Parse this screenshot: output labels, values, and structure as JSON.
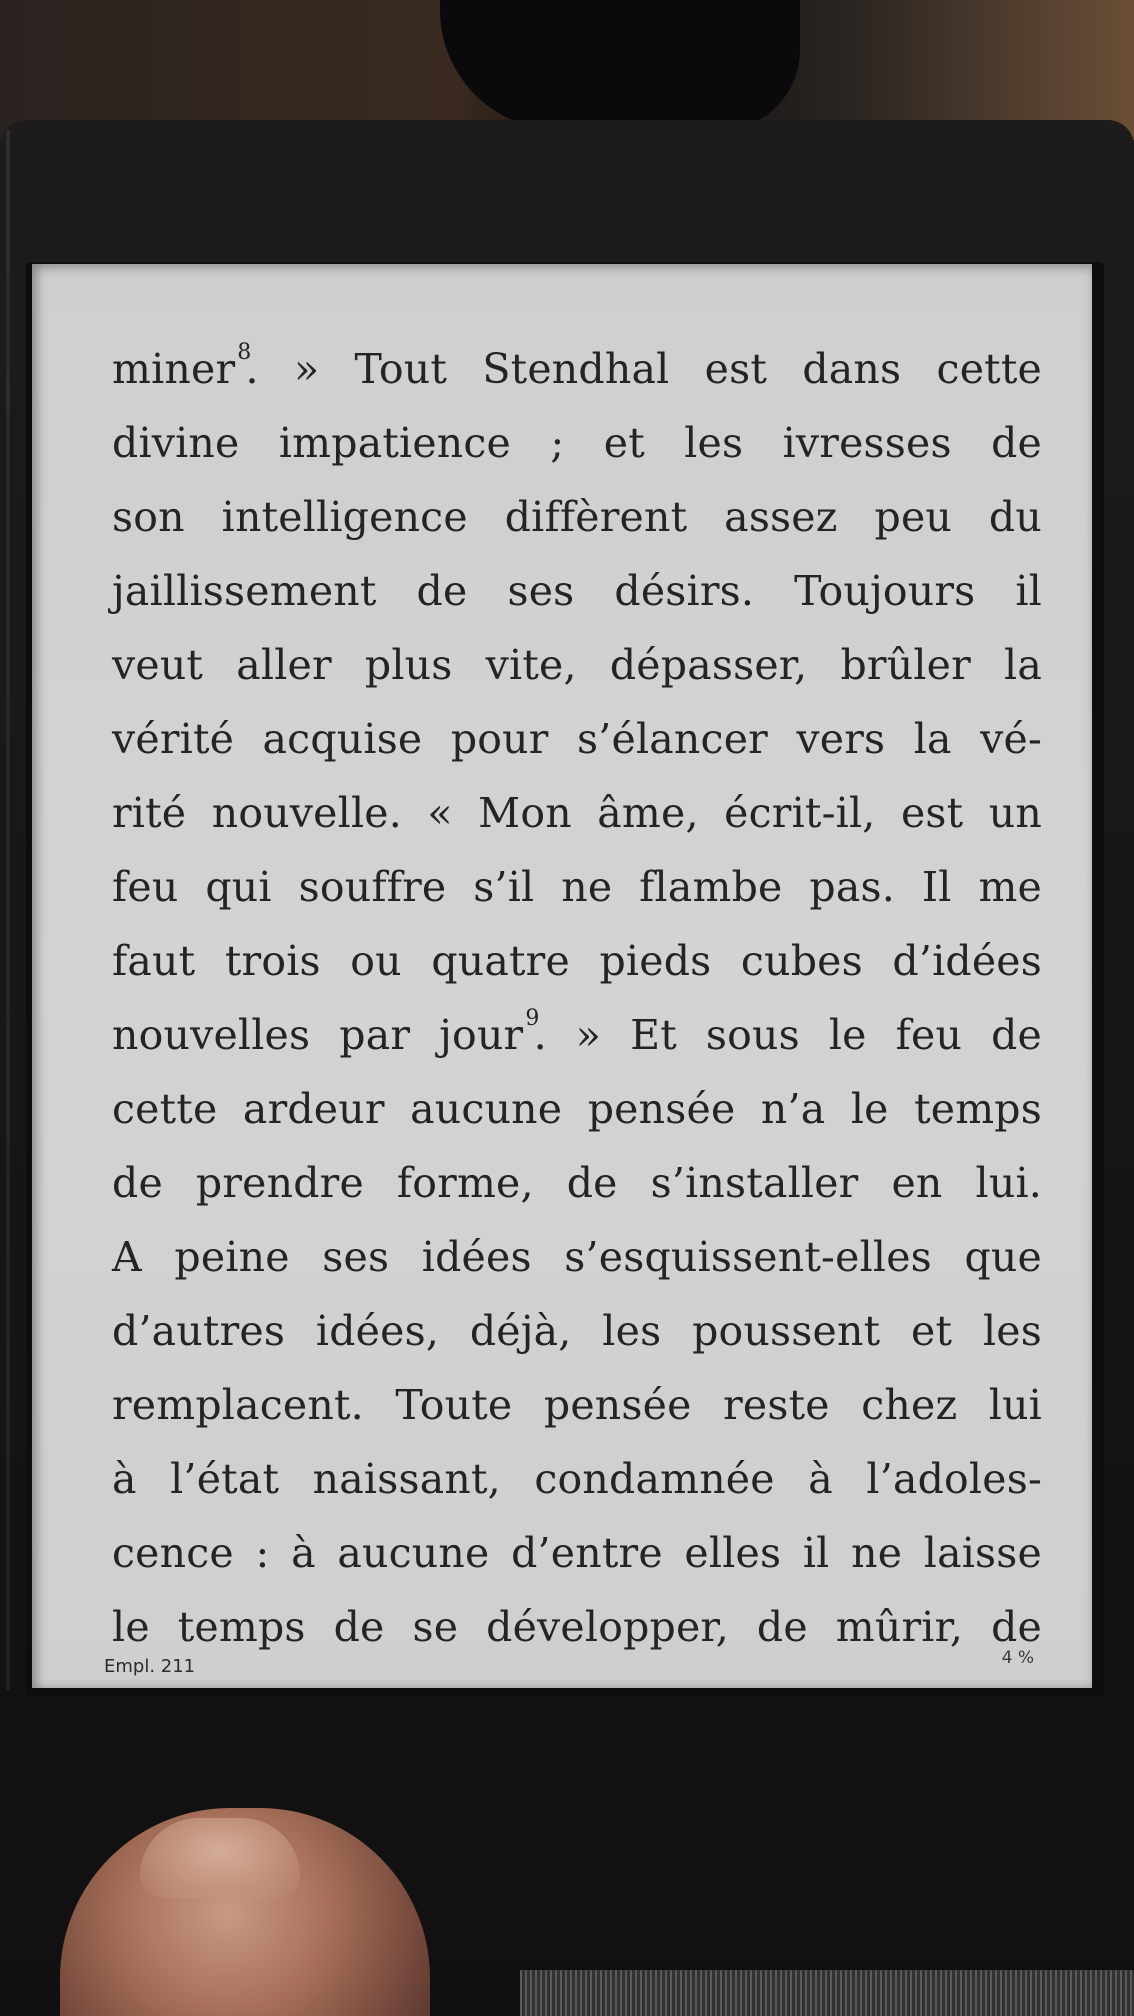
{
  "reader": {
    "paragraph_lines": [
      {
        "before": "miner",
        "ref": "8",
        "after": ". » Tout Stendhal est dans cette"
      },
      {
        "text": "divine impatience ; et les ivresses de"
      },
      {
        "text": "son intelligence diffèrent assez peu du"
      },
      {
        "text": "jaillissement de ses désirs. Toujours il"
      },
      {
        "text": "veut aller plus vite, dépasser, brûler la"
      },
      {
        "text": "vérité acquise pour s’élancer vers la vé-"
      },
      {
        "text": "rité nouvelle. « Mon âme, écrit-il, est un"
      },
      {
        "text": "feu qui souffre s’il ne flambe pas. Il me"
      },
      {
        "text": "faut trois ou quatre pieds cubes d’idées"
      },
      {
        "before": "nouvelles par jour",
        "ref": "9",
        "after": ". » Et sous le feu de"
      },
      {
        "text": "cette ardeur aucune pensée n’a le temps"
      },
      {
        "text": "de prendre forme, de s’installer en lui."
      },
      {
        "text": "A peine ses idées s’esquissent-elles que"
      },
      {
        "text": "d’autres idées, déjà, les poussent et les"
      },
      {
        "text": "remplacent. Toute pensée reste chez lui"
      },
      {
        "text": "à l’état naissant, condamnée à l’adoles-"
      },
      {
        "text": "cence : à aucune d’entre elles il ne laisse"
      },
      {
        "text": "le temps de se développer, de mûrir, de"
      }
    ],
    "footer": {
      "location": "Empl. 211",
      "progress": "4 %",
      "progress_value": 4
    }
  }
}
